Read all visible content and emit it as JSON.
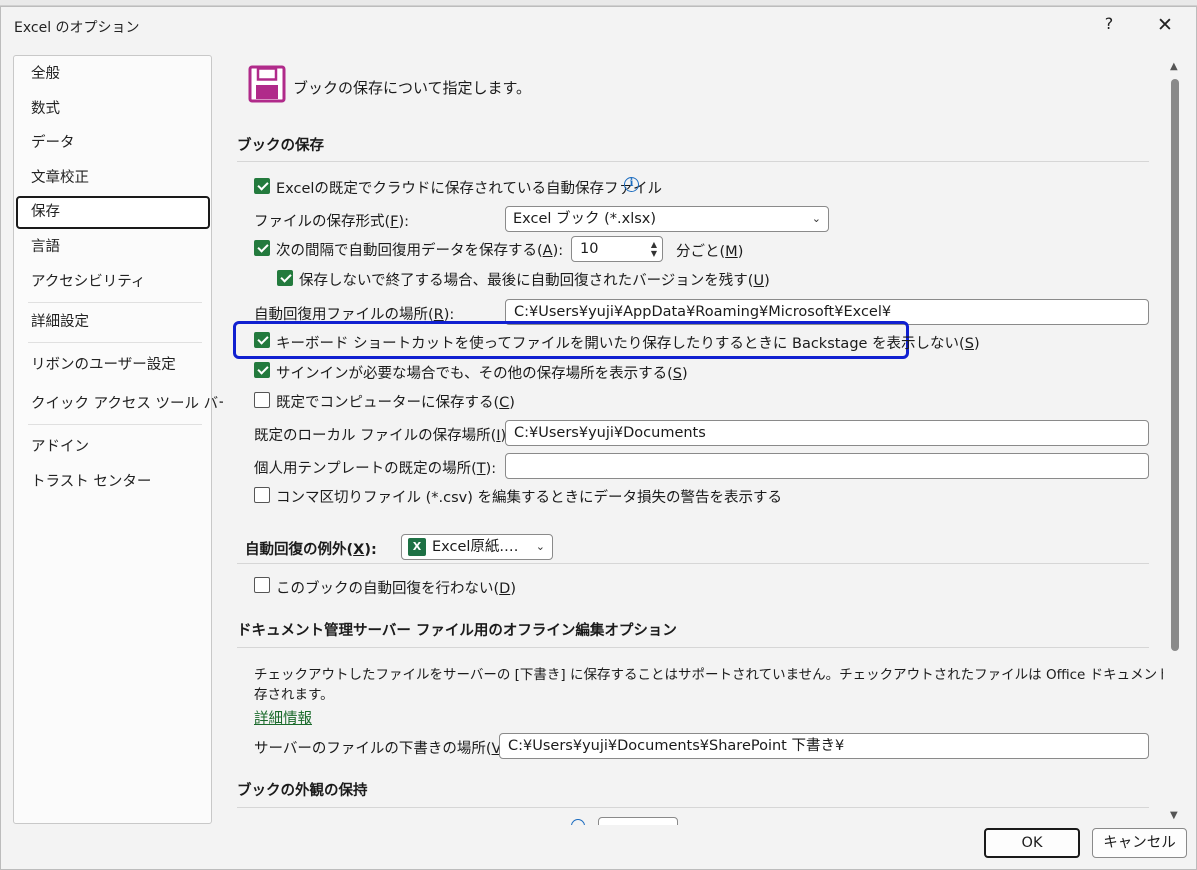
{
  "window": {
    "title": "Excel のオプション",
    "help": "?",
    "close": "✕"
  },
  "sidebar": {
    "items": [
      {
        "label": "全般"
      },
      {
        "label": "数式"
      },
      {
        "label": "データ"
      },
      {
        "label": "文章校正"
      },
      {
        "label": "保存",
        "selected": true
      },
      {
        "label": "言語"
      },
      {
        "label": "アクセシビリティ"
      },
      {
        "label": "詳細設定"
      },
      {
        "label": "リボンのユーザー設定"
      },
      {
        "label": "クイック アクセス ツール バー"
      },
      {
        "label": "アドイン"
      },
      {
        "label": "トラスト センター"
      }
    ]
  },
  "header": {
    "icon": "save-floppy-icon",
    "text": "ブックの保存について指定します。"
  },
  "save_section": {
    "title": "ブックの保存",
    "autosave_cloud": {
      "label": "Excelの既定でクラウドに保存されている自動保存ファイル",
      "checked": true
    },
    "file_format": {
      "label": "ファイルの保存形式(",
      "key": "F",
      "suffix": "):",
      "value": "Excel ブック (*.xlsx)"
    },
    "autorecover_interval": {
      "label": "次の間隔で自動回復用データを保存する(",
      "key": "A",
      "suffix": "):",
      "checked": true,
      "value": "10",
      "unit_prefix": "分ごと(",
      "unit_key": "M",
      "unit_suffix": ")"
    },
    "keep_last": {
      "label": "保存しないで終了する場合、最後に自動回復されたバージョンを残す(",
      "key": "U",
      "suffix": ")",
      "checked": true
    },
    "autorecover_location": {
      "label": "自動回復用ファイルの場所(",
      "key": "R",
      "suffix": "):",
      "value": "C:¥Users¥yuji¥AppData¥Roaming¥Microsoft¥Excel¥"
    },
    "no_backstage": {
      "label": "キーボード ショートカットを使ってファイルを開いたり保存したりするときに Backstage を表示しない(",
      "key": "S",
      "suffix": ")",
      "checked": true
    },
    "show_other_locations": {
      "label": "サインインが必要な場合でも、その他の保存場所を表示する(",
      "key": "S",
      "suffix": ")",
      "checked": true
    },
    "save_to_computer": {
      "label": "既定でコンピューターに保存する(",
      "key": "C",
      "suffix": ")",
      "checked": false
    },
    "default_local_location": {
      "label": "既定のローカル ファイルの保存場所(",
      "key": "I",
      "suffix": "):",
      "value": "C:¥Users¥yuji¥Documents"
    },
    "personal_template_location": {
      "label": "個人用テンプレートの既定の場所(",
      "key": "T",
      "suffix": "):",
      "value": ""
    },
    "csv_warning": {
      "label": "コンマ区切りファイル (*.csv) を編集するときにデータ損失の警告を表示する",
      "checked": false
    }
  },
  "autorecover_exceptions": {
    "label": "自動回復の例外(",
    "key": "X",
    "suffix": "):",
    "workbook": "Excel原紙.…",
    "disable": {
      "label": "このブックの自動回復を行わない(",
      "key": "D",
      "suffix": ")",
      "checked": false
    }
  },
  "offline_section": {
    "title": "ドキュメント管理サーバー ファイル用のオフライン編集オプション",
    "description_line1": "チェックアウトしたファイルをサーバーの [下書き] に保存することはサポートされていません。チェックアウトされたファイルは Office ドキュメント キャッシュに保",
    "description_line2": "存されます。",
    "link": "詳細情報",
    "drafts_location": {
      "label": "サーバーのファイルの下書きの場所(",
      "key": "V",
      "suffix": "):",
      "value": "C:¥Users¥yuji¥Documents¥SharePoint 下書き¥"
    }
  },
  "appearance_section": {
    "title": "ブックの外観の保持"
  },
  "buttons": {
    "ok": "OK",
    "cancel": "キャンセル"
  },
  "colors": {
    "checkbox": "#237a3d",
    "highlight": "#1020d0",
    "link": "#1a6a2b"
  }
}
